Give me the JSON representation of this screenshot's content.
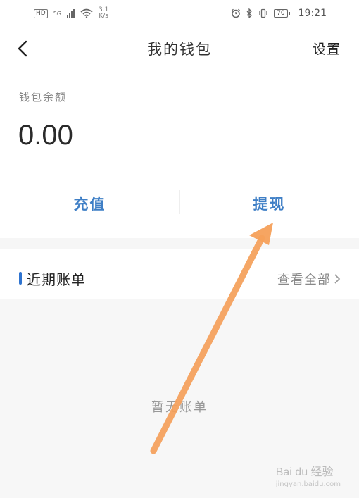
{
  "status_bar": {
    "net_badge": "HD",
    "net_type": "5G",
    "speed_value": "3.1",
    "speed_unit": "K/s",
    "battery": "70",
    "time": "19:21"
  },
  "nav": {
    "title": "我的钱包",
    "settings_label": "设置"
  },
  "wallet": {
    "balance_label": "钱包余额",
    "balance": "0.00"
  },
  "actions": {
    "recharge_label": "充值",
    "withdraw_label": "提现"
  },
  "bills": {
    "title": "近期账单",
    "view_all_label": "查看全部",
    "empty_text": "暂无账单"
  },
  "watermark": {
    "brand": "Bai du 经验",
    "url": "jingyan.baidu.com"
  },
  "colors": {
    "accent": "#3f7fc6",
    "section_bar": "#2f74d0",
    "annotation_arrow": "#f5a05a"
  }
}
